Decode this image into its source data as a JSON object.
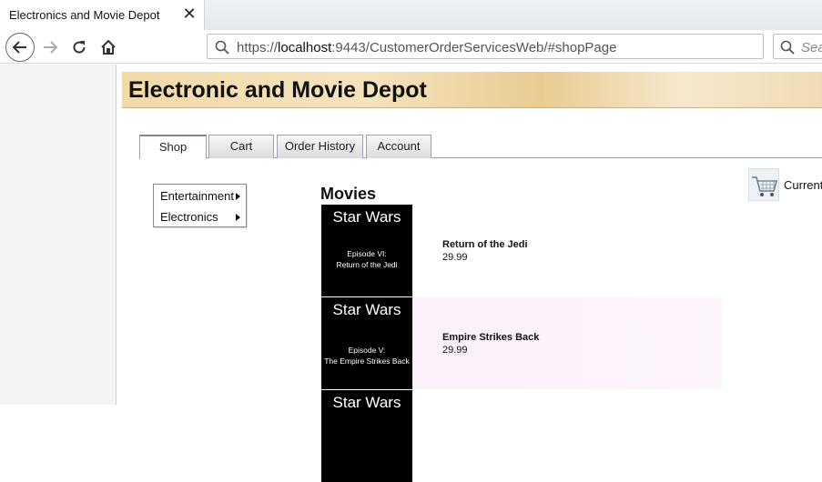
{
  "browser": {
    "tab_title": "Electronics and Movie Depot",
    "url_prefix": "https://",
    "url_host": "localhost",
    "url_rest": ":9443/CustomerOrderServicesWeb/#shopPage",
    "search_placeholder": "Sea"
  },
  "page": {
    "banner_title": "Electronic and Movie Depot",
    "tabs": [
      {
        "label": "Shop",
        "active": true
      },
      {
        "label": "Cart"
      },
      {
        "label": "Order History"
      },
      {
        "label": "Account"
      }
    ],
    "category_menu": [
      {
        "label": "Entertainment"
      },
      {
        "label": "Electronics"
      }
    ],
    "section_title": "Movies",
    "cart_status": "Current",
    "products": [
      {
        "poster_title": "Star Wars",
        "poster_sub": [
          "Episode VI:",
          "Return of the Jedi"
        ],
        "name": "Return of the Jedi",
        "price": "29.99"
      },
      {
        "poster_title": "Star Wars",
        "poster_sub": [
          "Episode V:",
          "The Empire Strikes Back"
        ],
        "name": "Empire Strikes Back",
        "price": "29.99"
      },
      {
        "poster_title": "Star Wars",
        "poster_sub": [],
        "name": "",
        "price": ""
      }
    ]
  }
}
